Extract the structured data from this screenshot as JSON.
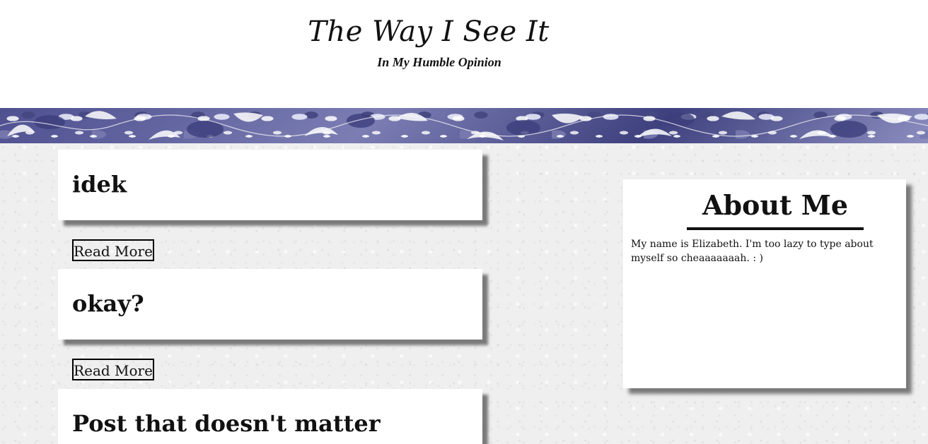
{
  "header": {
    "title": "The Way I See It",
    "subtitle": "In My Humble Opinion"
  },
  "posts": [
    {
      "title": "idek",
      "read_more_label": "Read More"
    },
    {
      "title": "okay?",
      "read_more_label": "Read More"
    },
    {
      "title": "Post that doesn't matter"
    }
  ],
  "about": {
    "heading": "About Me",
    "body": "My name is Elizabeth. I'm too lazy to type about myself so cheaaaaaaah. : )"
  },
  "colors": {
    "banner_accent": "#5a5c94",
    "card_background": "#ffffff",
    "page_background": "#efefef",
    "text": "#111111"
  }
}
